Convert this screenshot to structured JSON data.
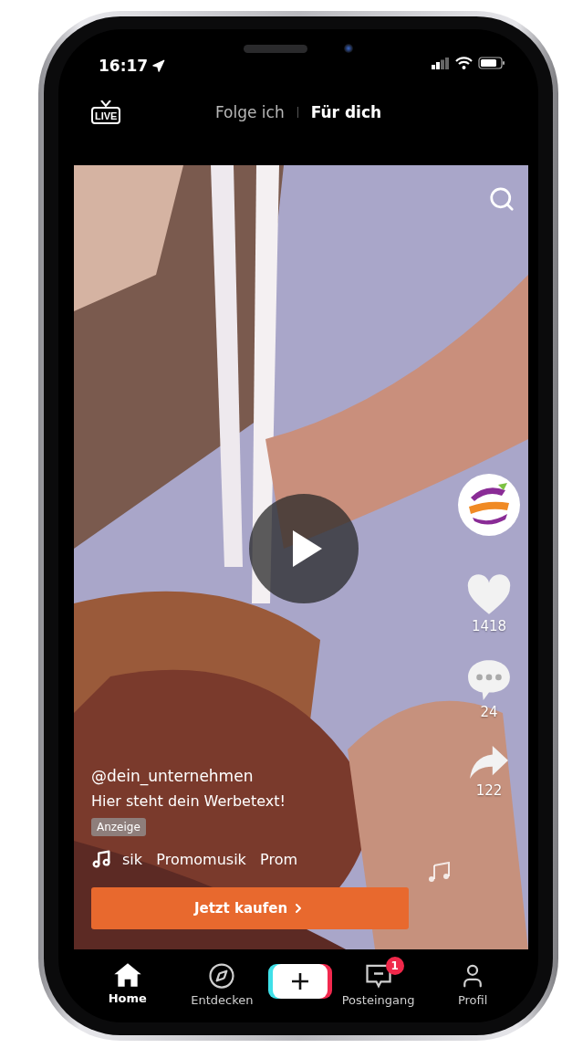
{
  "status_bar": {
    "time": "16:17"
  },
  "live": {
    "label": "LIVE"
  },
  "top_tabs": [
    {
      "label": "Folge ich",
      "selected": false
    },
    {
      "label": "Für dich",
      "selected": true
    }
  ],
  "video": {
    "kind": "picture",
    "paused": true
  },
  "actions": [
    {
      "kind": "avatar"
    },
    {
      "kind": "like",
      "count": "1418"
    },
    {
      "kind": "comment",
      "count": "24"
    },
    {
      "kind": "share",
      "count": "122"
    }
  ],
  "caption": {
    "username": "@dein_unternehmen",
    "text": "Hier steht dein Werbetext!",
    "badge": "Anzeige",
    "music": "sik   Promomusik   Prom"
  },
  "cta": {
    "label": "Jetzt kaufen"
  },
  "nav": [
    {
      "kind": "home",
      "label": "Home",
      "selected": true
    },
    {
      "kind": "discover",
      "label": "Entdecken",
      "selected": false
    },
    {
      "kind": "create"
    },
    {
      "kind": "inbox",
      "label": "Posteingang",
      "selected": false,
      "badge": "1"
    },
    {
      "kind": "profile",
      "label": "Profil",
      "selected": false
    }
  ]
}
